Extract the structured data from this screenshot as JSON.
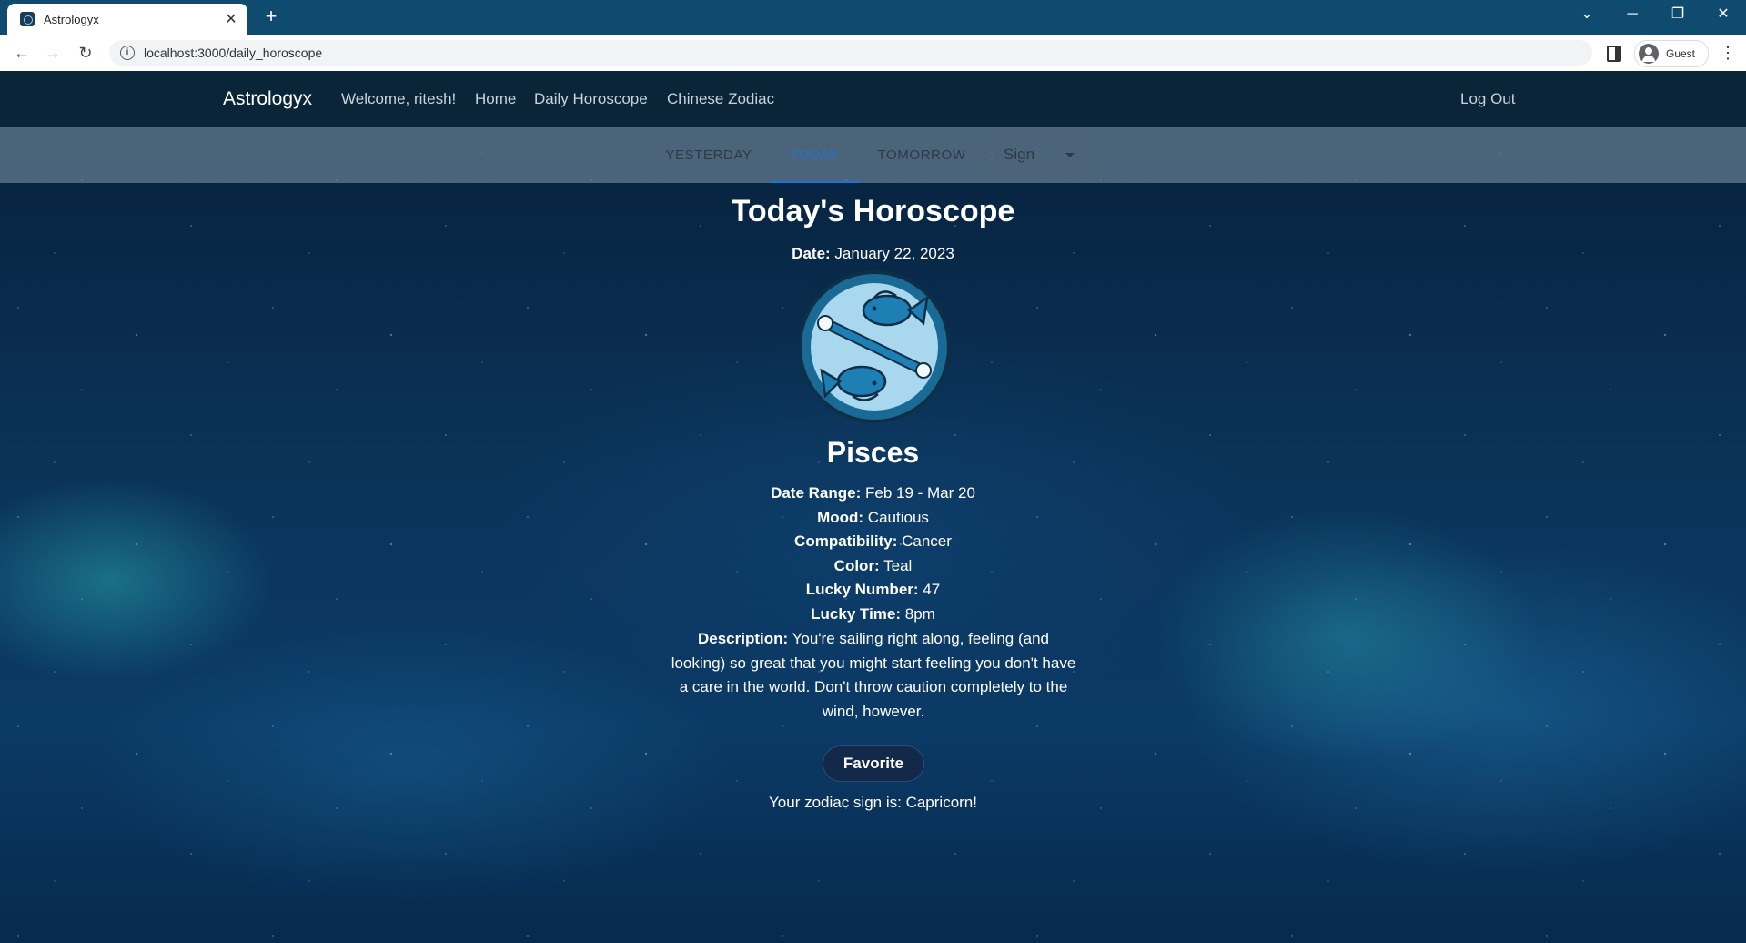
{
  "browser": {
    "tab_title": "Astrologyx",
    "tab_close": "✕",
    "new_tab": "+",
    "url": "localhost:3000/daily_horoscope",
    "profile_label": "Guest"
  },
  "nav": {
    "brand": "Astrologyx",
    "welcome": "Welcome, ritesh!",
    "home": "Home",
    "daily_horoscope": "Daily Horoscope",
    "chinese_zodiac": "Chinese Zodiac",
    "logout": "Log Out"
  },
  "day_tabs": {
    "yesterday": "YESTERDAY",
    "today": "TODAY",
    "tomorrow": "TOMORROW",
    "active": "TODAY"
  },
  "sign_select": {
    "value": "Sign"
  },
  "horoscope": {
    "heading": "Today's Horoscope",
    "date_label": "Date:",
    "date": "January 22, 2023",
    "sign_icon": "pisces-fish-icon",
    "sign": "Pisces",
    "date_range_label": "Date Range:",
    "date_range": "Feb 19 - Mar 20",
    "mood_label": "Mood:",
    "mood": "Cautious",
    "compatibility_label": "Compatibility:",
    "compatibility": "Cancer",
    "color_label": "Color:",
    "color": "Teal",
    "lucky_number_label": "Lucky Number:",
    "lucky_number": "47",
    "lucky_time_label": "Lucky Time:",
    "lucky_time": "8pm",
    "description_label": "Description:",
    "description": "You're sailing right along, feeling (and looking) so great that you might start feeling you don't have a care in the world. Don't throw caution completely to the wind, however."
  },
  "favorite_button": "Favorite",
  "zodiac_message": "Your zodiac sign is: Capricorn!",
  "colors": {
    "nav_bg": "#0a2438",
    "active_tab": "#1976d2",
    "button_bg": "#13294a"
  }
}
